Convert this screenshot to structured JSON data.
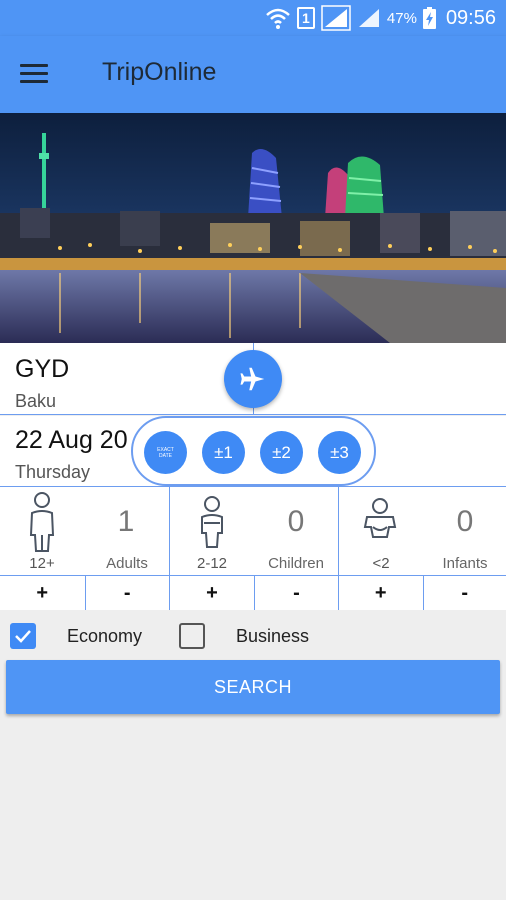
{
  "status_bar": {
    "sim": "1",
    "battery": "47%",
    "time": "09:56",
    "icons": [
      "wifi-icon",
      "sim-icon",
      "signal-icon",
      "signal-icon",
      "battery-charging-icon"
    ]
  },
  "app_bar": {
    "title": "TripOnline",
    "menu_icon": "hamburger-menu-icon"
  },
  "hero": {
    "image": "baku-night-skyline-photo"
  },
  "route": {
    "from_code": "GYD",
    "from_city": "Baku",
    "to_code": "",
    "to_city": "",
    "swap_icon": "airplane-icon"
  },
  "dates": {
    "depart_date": "22 Aug 20",
    "depart_day": "Thursday"
  },
  "flex_dates": {
    "exact_line1": "EXACT",
    "exact_line2": "DATE",
    "plus_minus_1": "±1",
    "plus_minus_2": "±2",
    "plus_minus_3": "±3"
  },
  "passengers": {
    "adults": {
      "range": "12+",
      "count": "1",
      "label": "Adults",
      "plus": "+",
      "minus": "-"
    },
    "children": {
      "range": "2-12",
      "count": "0",
      "label": "Children",
      "plus": "+",
      "minus": "-"
    },
    "infants": {
      "range": "<2",
      "count": "0",
      "label": "Infants",
      "plus": "+",
      "minus": "-"
    }
  },
  "cabin_class": {
    "economy_label": "Economy",
    "economy_checked": true,
    "business_label": "Business",
    "business_checked": false
  },
  "search": {
    "label": "SEARCH"
  },
  "colors": {
    "primary": "#4f95f5",
    "accent_button": "#3f8af5",
    "divider": "#6d9df0",
    "background": "#eeeeee"
  }
}
